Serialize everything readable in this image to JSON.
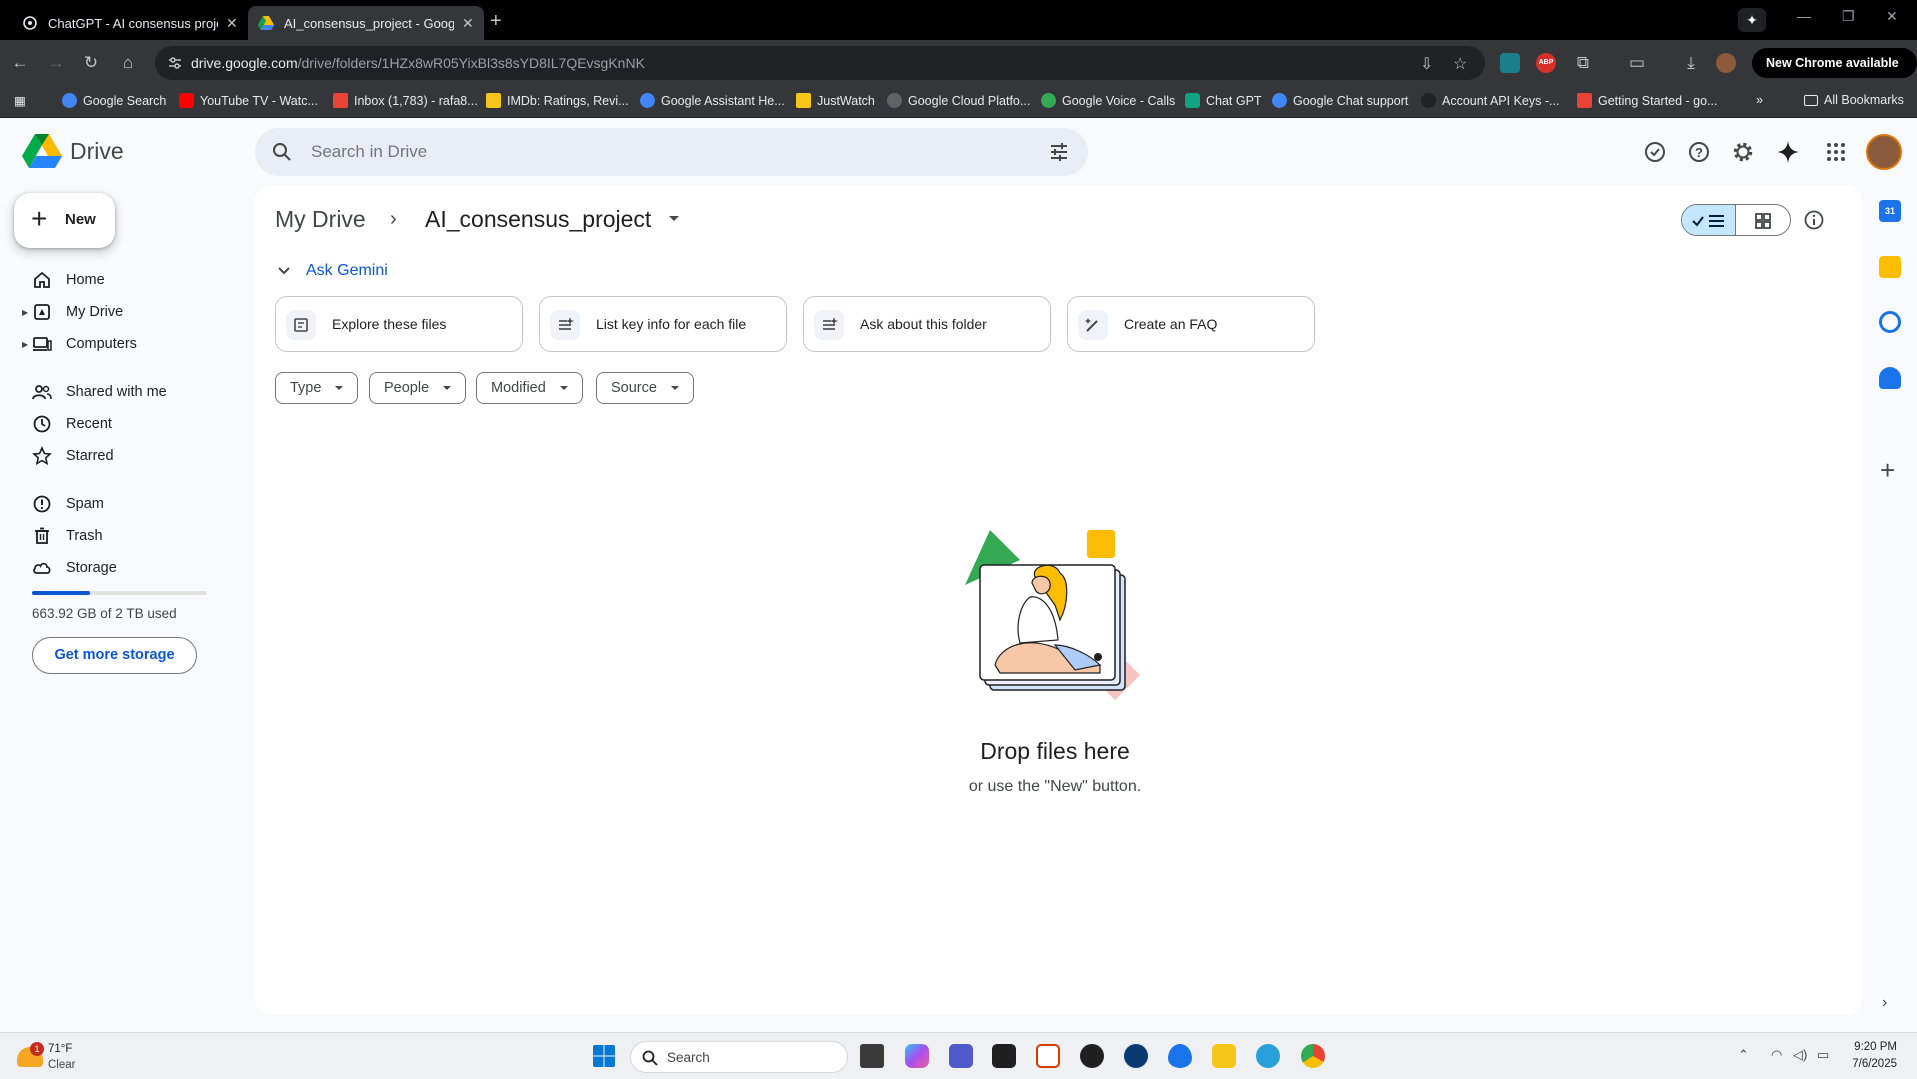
{
  "browser": {
    "tabs": [
      {
        "title": "ChatGPT - AI consensus project",
        "active": false
      },
      {
        "title": "AI_consensus_project - Google Drive",
        "active": true
      }
    ],
    "url_host": "drive.google.com",
    "url_path": "/drive/folders/1HZx8wR05YixBl3s8sYD8IL7QEvsgKnNK",
    "new_chrome_label": "New Chrome available",
    "bookmarks": [
      "Google Search",
      "YouTube TV - Watc...",
      "Inbox (1,783) - rafa8...",
      "IMDb: Ratings, Revi...",
      "Google Assistant He...",
      "JustWatch",
      "Google Cloud Platfo...",
      "Google Voice - Calls",
      "Chat GPT",
      "Google Chat support",
      "Account API Keys -...",
      "Getting Started - go..."
    ],
    "all_bookmarks_label": "All Bookmarks"
  },
  "drive": {
    "app_name": "Drive",
    "search_placeholder": "Search in Drive",
    "new_label": "New",
    "nav": [
      {
        "label": "Home",
        "icon": "home-icon"
      },
      {
        "label": "My Drive",
        "icon": "my-drive-icon"
      },
      {
        "label": "Computers",
        "icon": "computers-icon"
      },
      {
        "label": "Shared with me",
        "icon": "shared-icon"
      },
      {
        "label": "Recent",
        "icon": "clock-icon"
      },
      {
        "label": "Starred",
        "icon": "star-icon"
      },
      {
        "label": "Spam",
        "icon": "spam-icon"
      },
      {
        "label": "Trash",
        "icon": "trash-icon"
      },
      {
        "label": "Storage",
        "icon": "cloud-icon"
      }
    ],
    "storage": {
      "used_text": "663.92 GB of 2 TB used",
      "used_fraction": 0.33,
      "button_label": "Get more storage"
    },
    "breadcrumb": {
      "root": "My Drive",
      "current": "AI_consensus_project"
    },
    "gemini": {
      "label": "Ask Gemini",
      "chips": [
        "Explore these files",
        "List key info for each file",
        "Ask about this folder",
        "Create an FAQ"
      ]
    },
    "filters": [
      "Type",
      "People",
      "Modified",
      "Source"
    ],
    "empty": {
      "title": "Drop files here",
      "subtitle": "or use the \"New\" button."
    },
    "colors": {
      "accent": "#0b57d0",
      "selected_view": "#c2e7ff"
    }
  },
  "taskbar": {
    "weather_temp": "71°F",
    "weather_cond": "Clear",
    "weather_badge": "1",
    "search_label": "Search",
    "time": "9:20 PM",
    "date": "7/6/2025"
  }
}
